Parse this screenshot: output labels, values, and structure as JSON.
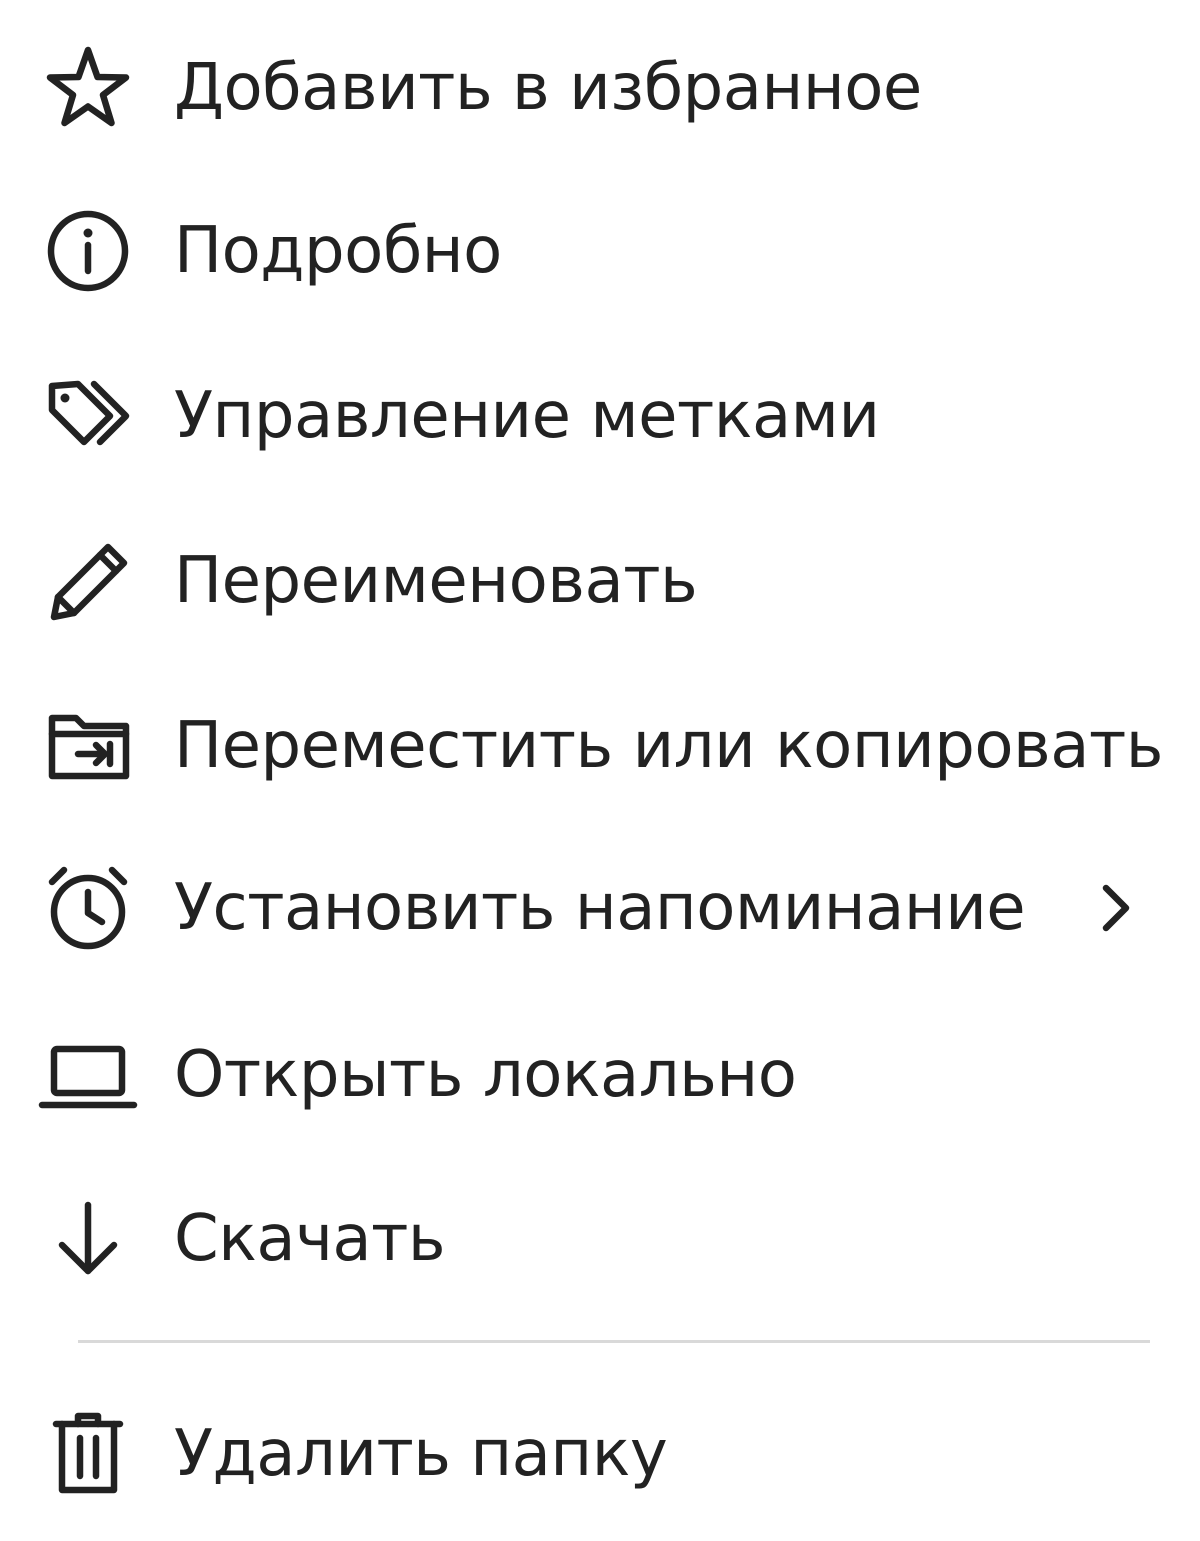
{
  "menu": {
    "items": [
      {
        "icon": "star-icon",
        "label": "Добавить в избранное"
      },
      {
        "icon": "info-icon",
        "label": "Подробно"
      },
      {
        "icon": "tags-icon",
        "label": "Управление метками"
      },
      {
        "icon": "pencil-icon",
        "label": "Переименовать"
      },
      {
        "icon": "folder-move-icon",
        "label": "Переместить или копировать"
      },
      {
        "icon": "alarm-clock-icon",
        "label": "Установить напоминание",
        "has_submenu": true
      },
      {
        "icon": "laptop-icon",
        "label": "Открыть локально"
      },
      {
        "icon": "download-arrow-icon",
        "label": "Скачать"
      }
    ],
    "danger_items": [
      {
        "icon": "trash-icon",
        "label": "Удалить папку"
      }
    ]
  },
  "colors": {
    "text": "#222222",
    "divider": "#d9d9d9",
    "background": "#ffffff"
  }
}
